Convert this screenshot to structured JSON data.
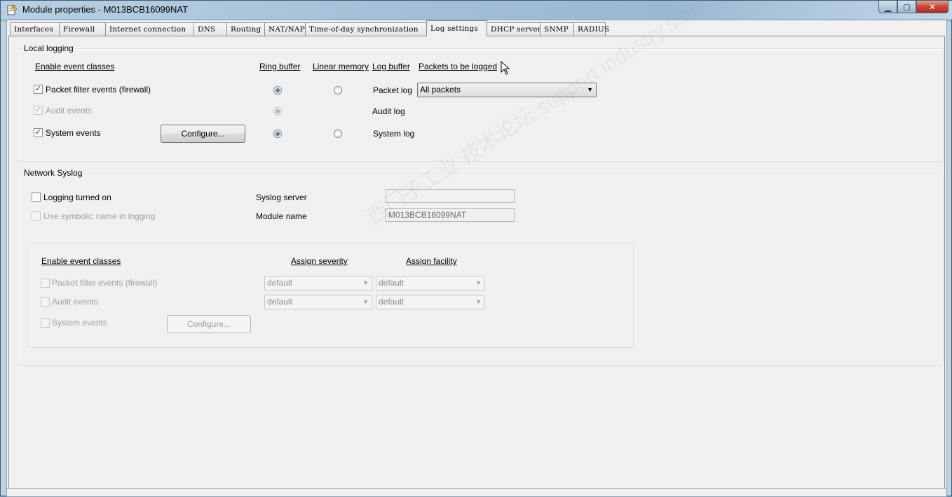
{
  "window": {
    "title": "Module properties - M013BCB16099NAT",
    "controls": {
      "minimize": "▁",
      "maximize": "▢",
      "close": "✕"
    }
  },
  "tabs": [
    {
      "label": "Interfaces",
      "active": false
    },
    {
      "label": "Firewall",
      "active": false
    },
    {
      "label": "Internet connection",
      "active": false
    },
    {
      "label": "DNS",
      "active": false
    },
    {
      "label": "Routing",
      "active": false
    },
    {
      "label": "NAT/NAPT",
      "active": false
    },
    {
      "label": "Time-of-day synchronization",
      "active": false
    },
    {
      "label": "Log settings",
      "active": true
    },
    {
      "label": "DHCP server",
      "active": false
    },
    {
      "label": "SNMP",
      "active": false
    },
    {
      "label": "RADIUS",
      "active": false
    }
  ],
  "local_logging": {
    "legend": "Local logging",
    "headers": {
      "enable_event_classes": "Enable event classes",
      "ring_buffer": "Ring buffer",
      "linear_memory": "Linear memory",
      "log_buffer": "Log buffer",
      "packets_to_be_logged": "Packets to be logged"
    },
    "rows": {
      "packet_filter": {
        "label": "Packet filter events (firewall)",
        "checked": true,
        "buffer_label": "Packet log"
      },
      "audit": {
        "label": "Audit events",
        "checked": true,
        "buffer_label": "Audit log"
      },
      "system": {
        "label": "System events",
        "checked": true,
        "buffer_label": "System log",
        "configure": "Configure..."
      }
    },
    "packets_combo": {
      "value": "All packets"
    }
  },
  "network_syslog": {
    "legend": "Network Syslog",
    "logging_on": {
      "label": "Logging turned on",
      "checked": false
    },
    "symbolic_name": {
      "label": "Use symbolic name in logging",
      "checked": false
    },
    "syslog_server": {
      "label": "Syslog server",
      "value": ""
    },
    "module_name": {
      "label": "Module name",
      "value": "M013BCB16099NAT"
    },
    "headers": {
      "enable_event_classes": "Enable event classes",
      "assign_severity": "Assign severity",
      "assign_facility": "Assign facility"
    },
    "rows": {
      "packet_filter": {
        "label": "Packet filter events (firewall)",
        "severity": "default",
        "facility": "default"
      },
      "audit": {
        "label": "Audit events",
        "severity": "default",
        "facility": "default"
      },
      "system": {
        "label": "System events",
        "configure": "Configure..."
      }
    }
  },
  "watermark": "西门子工业 技术论坛 support.industry.siemens.com/cs",
  "icons": {
    "check": "✓",
    "dropdown": "▼"
  }
}
